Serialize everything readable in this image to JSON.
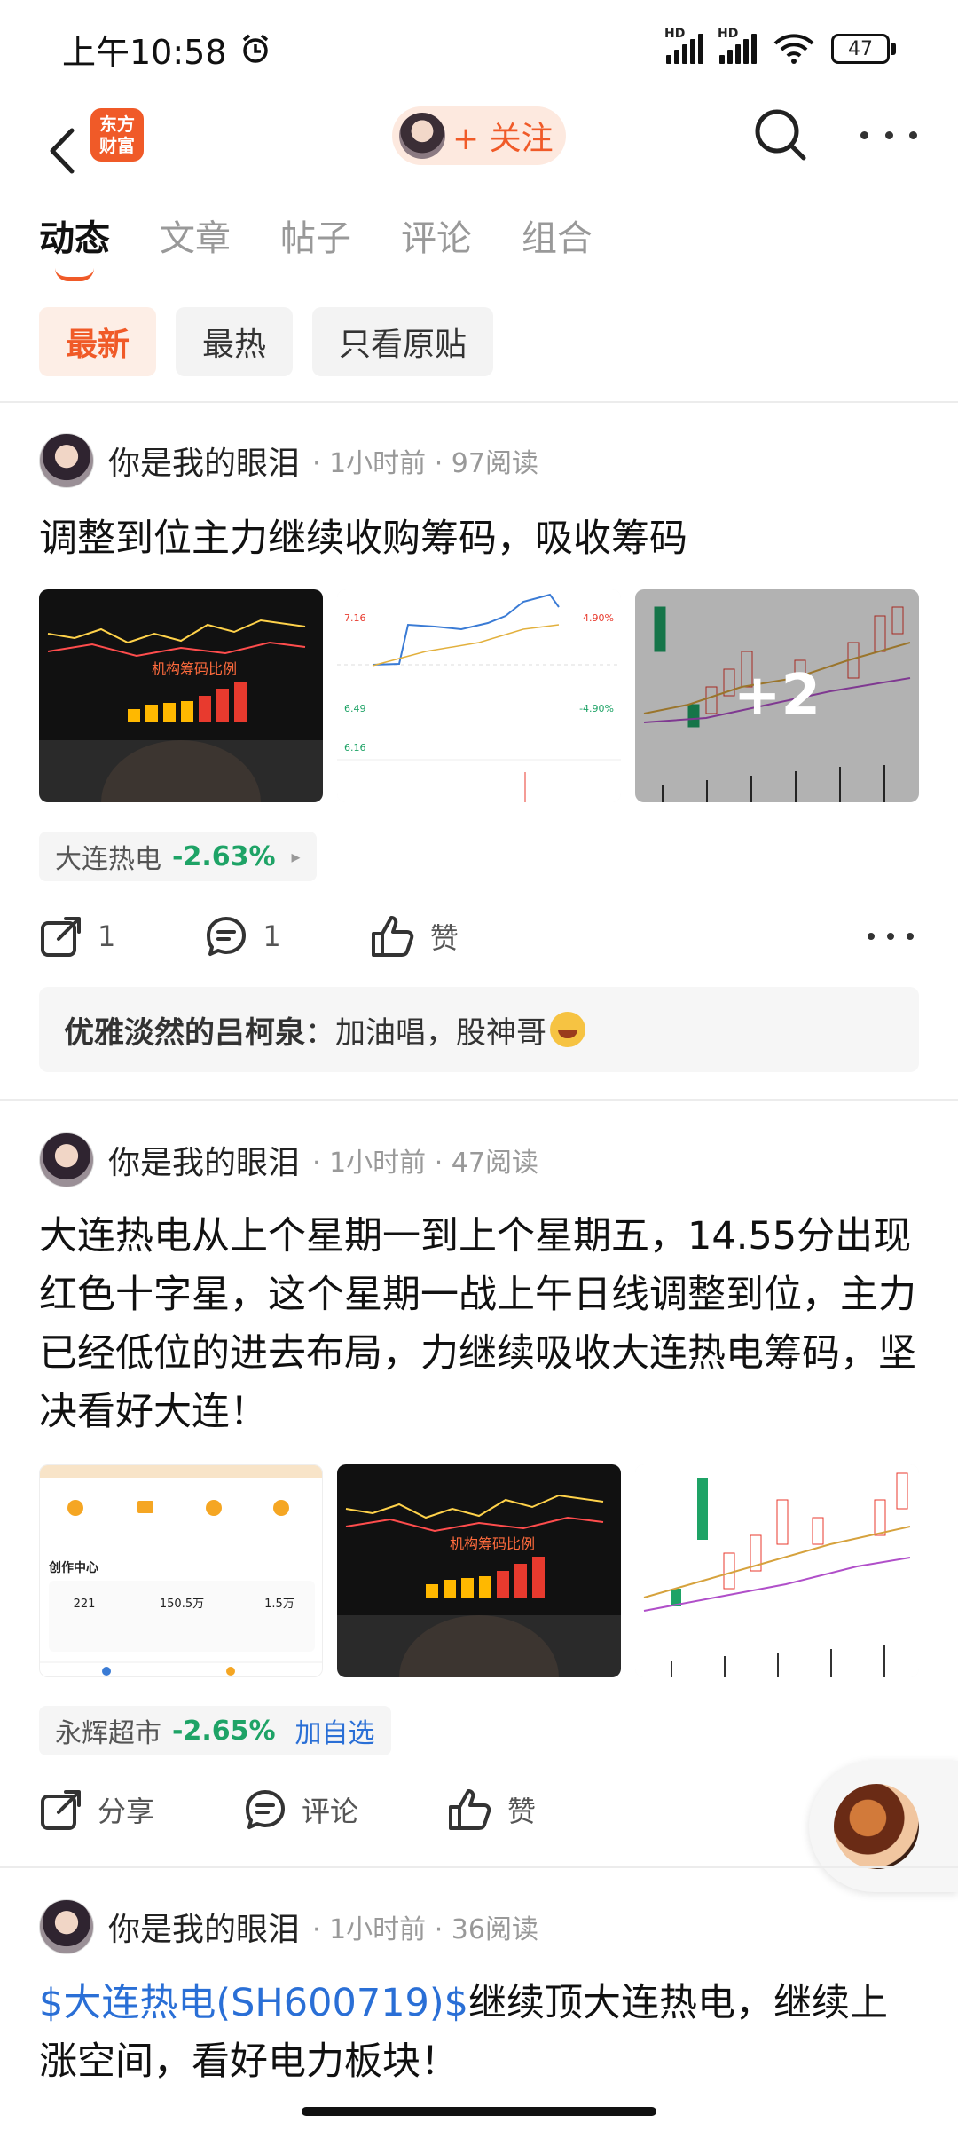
{
  "status_bar": {
    "time": "上午10:58",
    "battery": "47",
    "hd": "HD"
  },
  "header": {
    "brand_line1": "东方",
    "brand_line2": "财富",
    "follow_label": "+ 关注"
  },
  "tabs": [
    "动态",
    "文章",
    "帖子",
    "评论",
    "组合"
  ],
  "filters": [
    "最新",
    "最热",
    "只看原贴"
  ],
  "posts": [
    {
      "author": "你是我的眼泪",
      "time": "1小时前",
      "reads": "97阅读",
      "text": "调整到位主力继续收购筹码，吸收筹码",
      "more_images": "+2",
      "stock": {
        "name": "大连热电",
        "change": "-2.63%"
      },
      "actions": {
        "share": "1",
        "comment": "1",
        "like": "赞"
      },
      "comment": {
        "user": "优雅淡然的吕柯泉",
        "text": "加油唱，股神哥"
      }
    },
    {
      "author": "你是我的眼泪",
      "time": "1小时前",
      "reads": "47阅读",
      "text": "大连热电从上个星期一到上个星期五，14.55分出现红色十字星，这个星期一战上午日线调整到位，主力已经低位的进去布局，力继续吸收大连热电筹码，坚决看好大连！",
      "stock": {
        "name": "永辉超市",
        "change": "-2.65%",
        "add": "加自选"
      },
      "actions": {
        "share": "分享",
        "comment": "评论",
        "like": "赞"
      }
    },
    {
      "author": "你是我的眼泪",
      "time": "1小时前",
      "reads": "36阅读",
      "link": "$大连热电(SH600719)$",
      "text": "继续顶大连热电，继续上涨空间，看好电力板块！"
    }
  ],
  "thumb_texts": {
    "chip_ratio": "机构筹码比例",
    "creation_center": "创作中心",
    "fans": "221",
    "total_reads": "150.5万",
    "total_likes": "1.5万"
  }
}
